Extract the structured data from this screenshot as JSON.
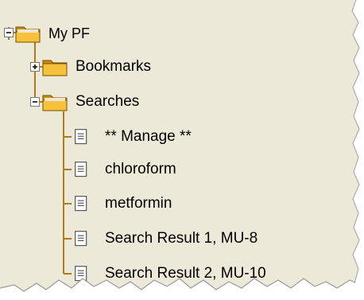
{
  "colors": {
    "panel_bg": "#ece9d8",
    "tree_line": "#b07a1e",
    "folder_fill": "#f6c13b",
    "folder_dark": "#c78c12",
    "doc_fill": "#ffffff",
    "doc_stroke": "#6b6b6b"
  },
  "tree": {
    "root": {
      "label": "My PF",
      "icon": "open-folder-icon",
      "expander": "minus"
    },
    "bookmarks": {
      "label": "Bookmarks",
      "icon": "folder-icon",
      "expander": "plus"
    },
    "searches": {
      "label": "Searches",
      "icon": "open-folder-icon",
      "expander": "minus",
      "items": [
        {
          "label": "** Manage **",
          "icon": "document-icon"
        },
        {
          "label": "chloroform",
          "icon": "document-icon"
        },
        {
          "label": "metformin",
          "icon": "document-icon"
        },
        {
          "label": "Search Result 1, MU-8",
          "icon": "document-icon"
        },
        {
          "label": "Search Result 2, MU-10",
          "icon": "document-icon"
        }
      ]
    }
  }
}
